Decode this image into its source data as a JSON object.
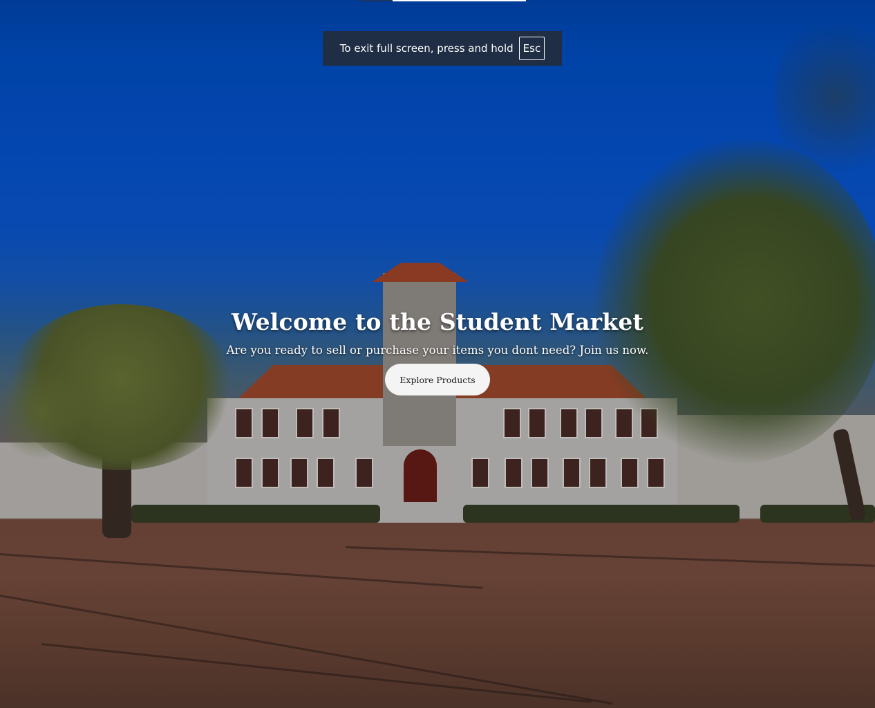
{
  "fullscreen_notice": {
    "text": "To exit full screen, press and hold",
    "key": "Esc"
  },
  "hero": {
    "title": "Welcome to the Student Market",
    "subtitle": "Are you ready to sell or purchase your items you dont need? Join us now.",
    "cta_label": "Explore Products"
  },
  "colors": {
    "sky": "#0552cc",
    "toast_bg": "#1f2d45",
    "button_bg": "#f4f4f4",
    "roof": "#a14a2c"
  }
}
